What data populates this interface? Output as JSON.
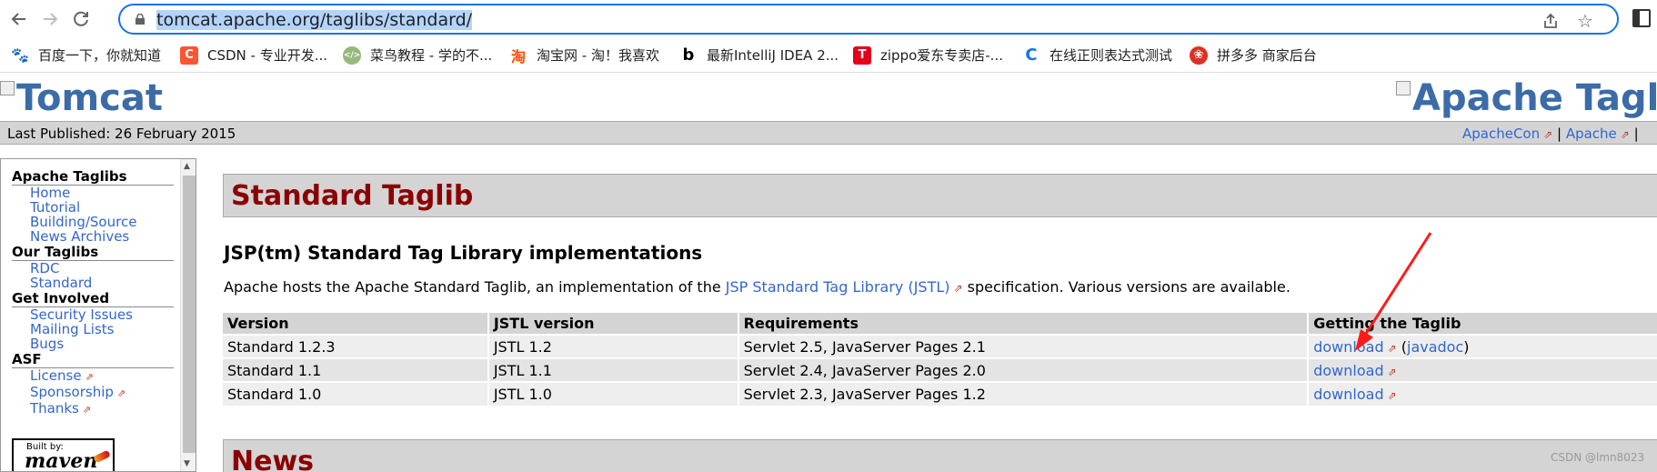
{
  "browser": {
    "url": "tomcat.apache.org/taglibs/standard/",
    "bookmarks": [
      {
        "label": "百度一下，你就知道",
        "icon": "baidu-paw-icon",
        "color": "#2932e1"
      },
      {
        "label": "CSDN - 专业开发...",
        "icon": "csdn-icon",
        "color": "#fc5531"
      },
      {
        "label": "菜鸟教程 - 学的不...",
        "icon": "runoob-icon",
        "color": "#96b97d"
      },
      {
        "label": "淘宝网 - 淘！我喜欢",
        "icon": "taobao-icon",
        "color": "#ff5000"
      },
      {
        "label": "最新IntelliJ IDEA 2...",
        "icon": "b-letter-icon",
        "color": "#000000"
      },
      {
        "label": "zippo爱东专卖店-...",
        "icon": "tmall-icon",
        "color": "#e4001b"
      },
      {
        "label": "在线正则表达式测试",
        "icon": "c-letter-icon",
        "color": "#1a73e8"
      },
      {
        "label": "拼多多 商家后台",
        "icon": "pinduoduo-icon",
        "color": "#e02e24"
      }
    ]
  },
  "page": {
    "logo_left": "Tomcat",
    "logo_right": "Apache Tagl",
    "published": "Last Published: 26 February 2015",
    "top_links": [
      "ApacheCon",
      "|",
      "Apache",
      "|"
    ],
    "menu": {
      "sections": [
        {
          "heading": "Apache Taglibs",
          "items": [
            {
              "label": "Home"
            },
            {
              "label": "Tutorial"
            },
            {
              "label": "Building/Source"
            },
            {
              "label": "News Archives"
            }
          ]
        },
        {
          "heading": "Our Taglibs",
          "items": [
            {
              "label": "RDC"
            },
            {
              "label": "Standard"
            }
          ]
        },
        {
          "heading": "Get Involved",
          "items": [
            {
              "label": "Security Issues"
            },
            {
              "label": "Mailing Lists"
            },
            {
              "label": "Bugs"
            }
          ]
        },
        {
          "heading": "ASF",
          "items": [
            {
              "label": "License"
            },
            {
              "label": "Sponsorship"
            },
            {
              "label": "Thanks"
            }
          ]
        }
      ],
      "badge_small": "Built by:",
      "badge_big": "maven"
    },
    "section_title": "Standard Taglib",
    "subheading": "JSP(tm) Standard Tag Library implementations",
    "intro_before": "Apache hosts the Apache Standard Taglib, an implementation of the ",
    "intro_link": "JSP Standard Tag Library (JSTL)",
    "intro_after": " specification. Various versions are available.",
    "table": {
      "headers": [
        "Version",
        "JSTL version",
        "Requirements",
        "Getting the Taglib"
      ],
      "rows": [
        {
          "version": "Standard 1.2.3",
          "jstl": "JSTL 1.2",
          "req": "Servlet 2.5, JavaServer Pages 2.1",
          "download": "download",
          "extra_open": " (",
          "extra": "javadoc",
          "extra_close": ")"
        },
        {
          "version": "Standard 1.1",
          "jstl": "JSTL 1.1",
          "req": "Servlet 2.4, JavaServer Pages 2.0",
          "download": "download"
        },
        {
          "version": "Standard 1.0",
          "jstl": "JSTL 1.0",
          "req": "Servlet 2.3, JavaServer Pages 1.2",
          "download": "download"
        }
      ]
    },
    "news_title": "News",
    "watermark": "CSDN @lmn8023"
  },
  "colors": {
    "accent": "#1a73e8",
    "link": "#3366cc",
    "title_red": "#8b0000",
    "annotation_arrow": "#ff1a1a"
  }
}
